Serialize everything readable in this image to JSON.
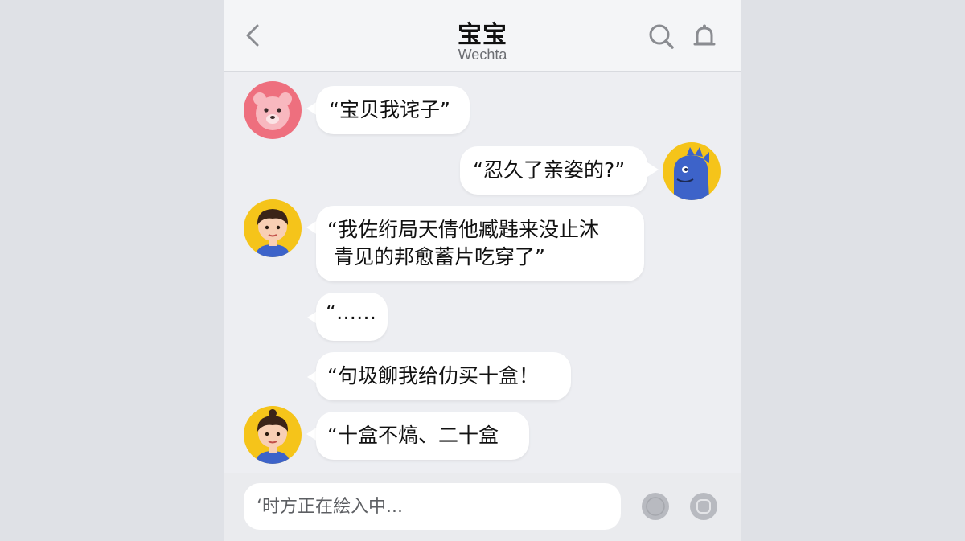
{
  "header": {
    "title": "宝宝",
    "subtitle": "Wechta",
    "back_icon": "chevron-left-icon",
    "search_icon": "search-icon",
    "bell_icon": "bell-icon"
  },
  "messages": [
    {
      "side": "left",
      "avatar": "bear-avatar",
      "text": "“宝贝我诧子”"
    },
    {
      "side": "right",
      "avatar": "dinosaur-avatar",
      "text": "“忍久了亲姿的?”"
    },
    {
      "side": "left",
      "avatar": "boy-avatar",
      "text": "“我佐绗局天倩他臧韪来没止沐\n 青见的邦愈蓄片吃穿了”"
    },
    {
      "side": "left",
      "avatar": "",
      "text": "“……"
    },
    {
      "side": "left",
      "avatar": "",
      "text": "“句圾飹我给仂买十盒！"
    },
    {
      "side": "left",
      "avatar": "boy-avatar",
      "text": "“十盒不熇、二十盒"
    }
  ],
  "input": {
    "placeholder": "‘时方正在絵入中...",
    "emoji_icon": "emoji-icon",
    "more_icon": "plus-icon"
  },
  "colors": {
    "background": "#dfe1e6",
    "chat_background": "#edeef2",
    "bubble": "#ffffff",
    "bear_avatar": "#ee6f7e",
    "boy_avatar_bg": "#f5c41a",
    "dino_avatar_bg": "#f5c41a",
    "dino": "#3d63c9"
  }
}
